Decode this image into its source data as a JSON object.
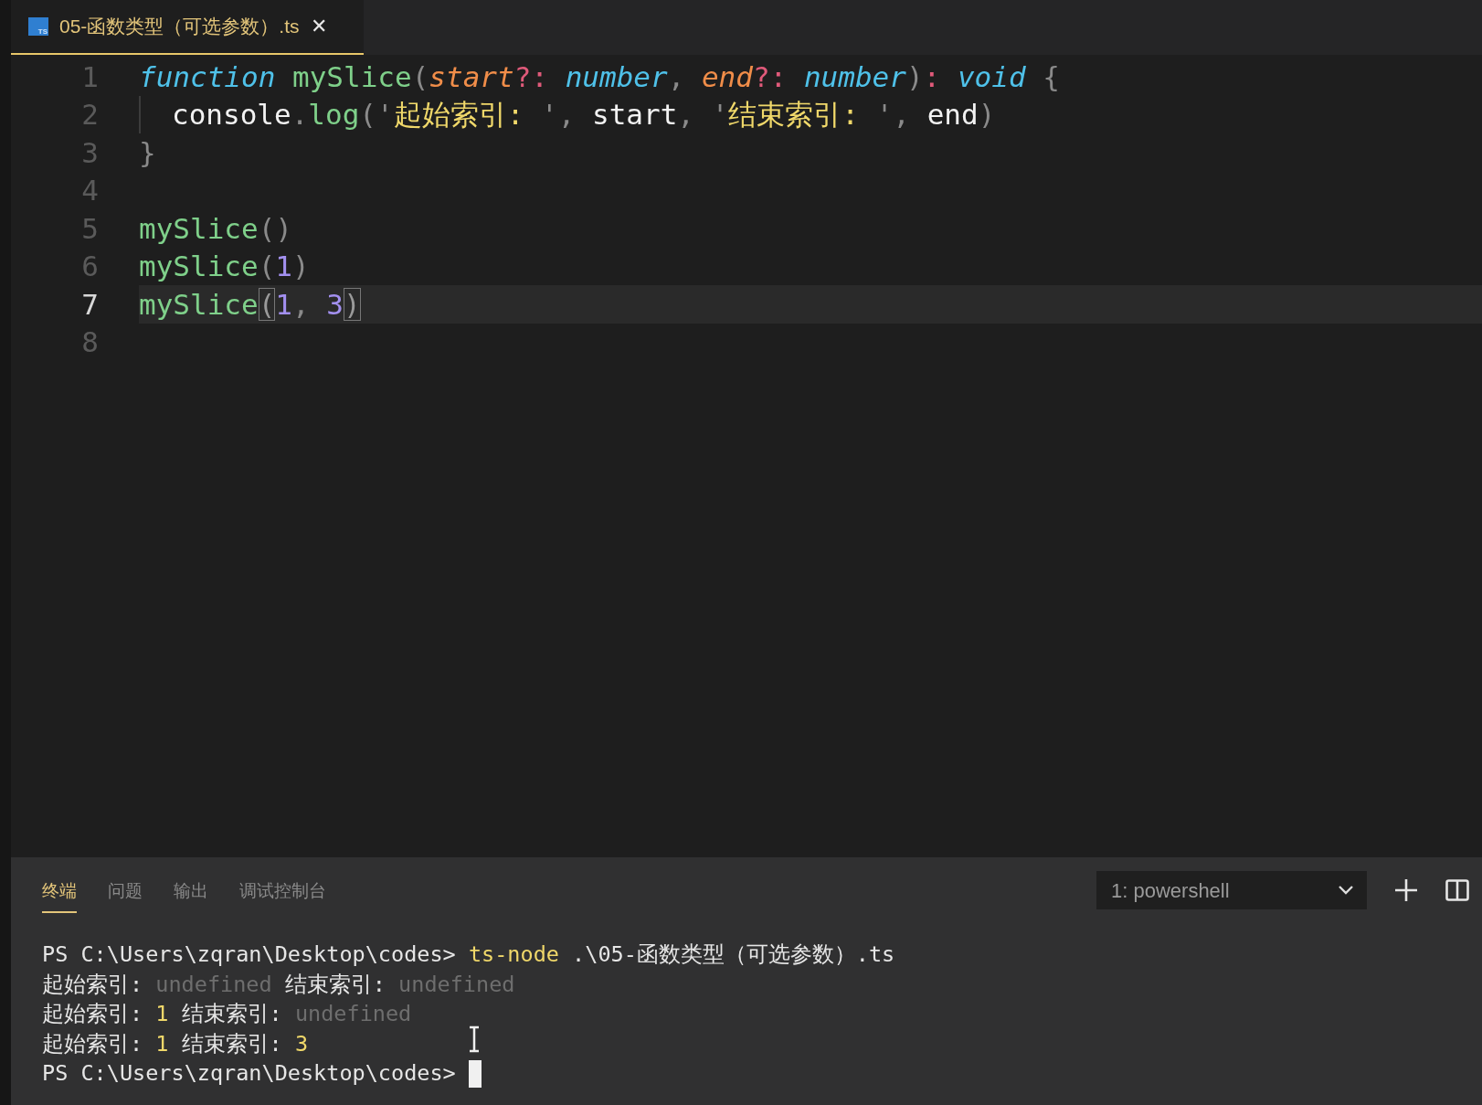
{
  "editor_tab": {
    "icon_label": "TS",
    "title": "05-函数类型（可选参数）.ts",
    "close": "✕",
    "selected": true
  },
  "code_lines": [
    {
      "number": "1",
      "current": false,
      "tokens": [
        {
          "kind": "keyword",
          "text": "function "
        },
        {
          "kind": "func",
          "text": "mySlice"
        },
        {
          "kind": "punct",
          "text": "("
        },
        {
          "kind": "param",
          "text": "start"
        },
        {
          "kind": "op",
          "text": "?: "
        },
        {
          "kind": "type",
          "text": "number"
        },
        {
          "kind": "punct",
          "text": ", "
        },
        {
          "kind": "param",
          "text": "end"
        },
        {
          "kind": "op",
          "text": "?: "
        },
        {
          "kind": "type",
          "text": "number"
        },
        {
          "kind": "punct",
          "text": ")"
        },
        {
          "kind": "op",
          "text": ": "
        },
        {
          "kind": "type",
          "text": "void "
        },
        {
          "kind": "punct",
          "text": "{"
        }
      ]
    },
    {
      "number": "2",
      "current": false,
      "indent": true,
      "tokens": [
        {
          "kind": "var",
          "text": "console"
        },
        {
          "kind": "punct",
          "text": "."
        },
        {
          "kind": "func",
          "text": "log"
        },
        {
          "kind": "punct",
          "text": "('"
        },
        {
          "kind": "string",
          "text": "起始索引: "
        },
        {
          "kind": "punct",
          "text": "', "
        },
        {
          "kind": "var",
          "text": "start"
        },
        {
          "kind": "punct",
          "text": ", '"
        },
        {
          "kind": "string",
          "text": "结束索引: "
        },
        {
          "kind": "punct",
          "text": "', "
        },
        {
          "kind": "var",
          "text": "end"
        },
        {
          "kind": "punct",
          "text": ")"
        }
      ]
    },
    {
      "number": "3",
      "current": false,
      "tokens": [
        {
          "kind": "punct",
          "text": "}"
        }
      ]
    },
    {
      "number": "4",
      "current": false
    },
    {
      "number": "5",
      "current": false,
      "tokens": [
        {
          "kind": "func",
          "text": "mySlice"
        },
        {
          "kind": "punct",
          "text": "()"
        }
      ]
    },
    {
      "number": "6",
      "current": false,
      "tokens": [
        {
          "kind": "func",
          "text": "mySlice"
        },
        {
          "kind": "punct",
          "text": "("
        },
        {
          "kind": "number",
          "text": "1"
        },
        {
          "kind": "punct",
          "text": ")"
        }
      ]
    },
    {
      "number": "7",
      "current": true,
      "tokens": [
        {
          "kind": "func",
          "text": "mySlice"
        },
        {
          "kind": "match",
          "text": "("
        },
        {
          "kind": "number",
          "text": "1"
        },
        {
          "kind": "punct",
          "text": ", "
        },
        {
          "kind": "number",
          "text": "3"
        },
        {
          "kind": "match",
          "text": ")"
        }
      ]
    },
    {
      "number": "8",
      "current": false
    }
  ],
  "panel_tabs": [
    {
      "label": "终端",
      "selected": true
    },
    {
      "label": "问题",
      "selected": false
    },
    {
      "label": "输出",
      "selected": false
    },
    {
      "label": "调试控制台",
      "selected": false
    }
  ],
  "terminal_select": {
    "value": "1: powershell"
  },
  "terminal_lines": [
    {
      "cursor": false,
      "segments": [
        {
          "kind": "text",
          "text": "PS C:\\Users\\zqran\\Desktop\\codes> "
        },
        {
          "kind": "command",
          "text": "ts-node"
        },
        {
          "kind": "text",
          "text": " .\\05-函数类型（可选参数）.ts"
        }
      ]
    },
    {
      "cursor": false,
      "segments": [
        {
          "kind": "text",
          "text": "起始索引: "
        },
        {
          "kind": "dim",
          "text": "undefined"
        },
        {
          "kind": "text",
          "text": " 结束索引: "
        },
        {
          "kind": "dim",
          "text": "undefined"
        }
      ]
    },
    {
      "cursor": false,
      "segments": [
        {
          "kind": "text",
          "text": "起始索引: "
        },
        {
          "kind": "number",
          "text": "1"
        },
        {
          "kind": "text",
          "text": " 结束索引: "
        },
        {
          "kind": "dim",
          "text": "undefined"
        }
      ]
    },
    {
      "cursor": false,
      "segments": [
        {
          "kind": "text",
          "text": "起始索引: "
        },
        {
          "kind": "number",
          "text": "1"
        },
        {
          "kind": "text",
          "text": " 结束索引: "
        },
        {
          "kind": "number",
          "text": "3"
        }
      ]
    },
    {
      "cursor": true,
      "segments": [
        {
          "kind": "text",
          "text": "PS C:\\Users\\zqran\\Desktop\\codes> "
        }
      ]
    }
  ]
}
